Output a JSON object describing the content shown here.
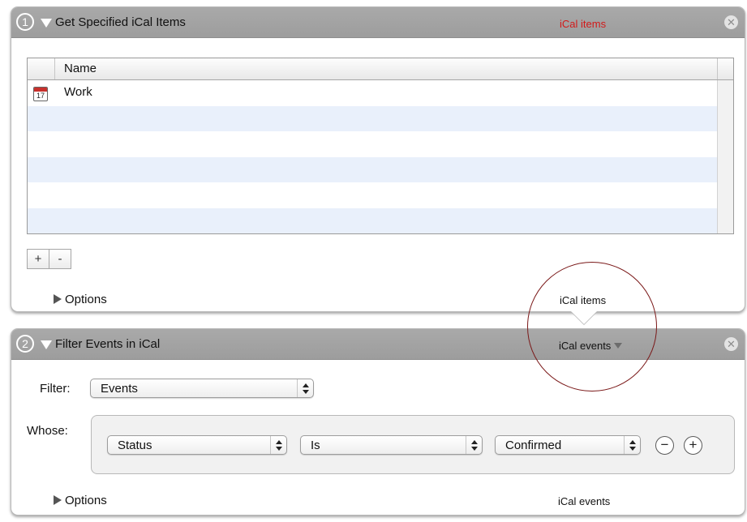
{
  "action1": {
    "step": "1",
    "title": "Get Specified iCal Items",
    "input_type": "iCal items",
    "close_glyph": "✕",
    "table": {
      "column_header": "Name",
      "rows": [
        {
          "icon": "calendar-icon",
          "icon_day": "17",
          "label": "Work"
        }
      ]
    },
    "add_label": "+",
    "remove_label": "-",
    "options_label": "Options",
    "output_type": "iCal items"
  },
  "action2": {
    "step": "2",
    "title": "Filter Events in iCal",
    "input_type": "iCal events",
    "close_glyph": "✕",
    "filter_label": "Filter:",
    "filter_value": "Events",
    "whose_label": "Whose:",
    "criterion": {
      "field": "Status",
      "operator": "Is",
      "value": "Confirmed"
    },
    "remove_criterion_label": "−",
    "add_criterion_label": "+",
    "options_label": "Options",
    "output_type": "iCal events"
  },
  "colors": {
    "header_gray": "#a3a3a3",
    "input_type_red": "#d21a1a",
    "row_alt": "#e9f0fb",
    "annotation": "#7a1818"
  }
}
